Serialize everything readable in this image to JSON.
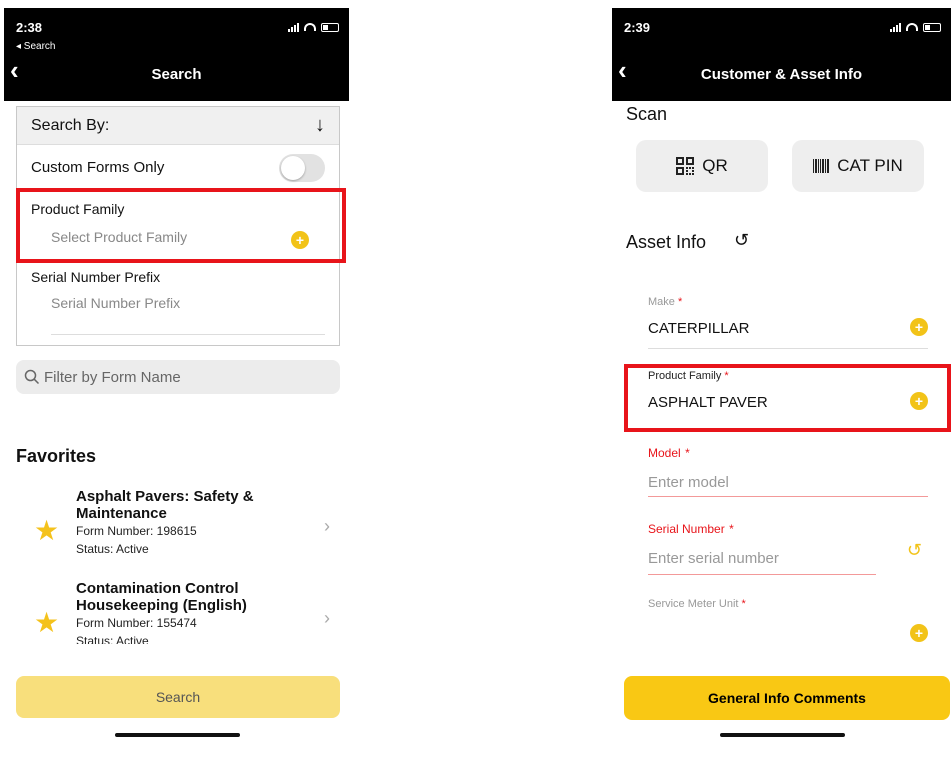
{
  "left": {
    "status": {
      "time": "2:38",
      "sub": "◂ Search"
    },
    "header": {
      "title": "Search"
    },
    "search_by": {
      "label": "Search By:"
    },
    "custom_forms": {
      "label": "Custom Forms Only"
    },
    "product_family": {
      "label": "Product Family",
      "placeholder": "Select Product Family"
    },
    "serial_prefix": {
      "label": "Serial Number Prefix",
      "placeholder": "Serial Number Prefix"
    },
    "filter": {
      "placeholder": "Filter by Form Name"
    },
    "favorites": {
      "title": "Favorites",
      "items": [
        {
          "name": "Asphalt Pavers: Safety & Maintenance",
          "form_number": "Form Number: 198615",
          "status": "Status: Active"
        },
        {
          "name": "Contamination Control Housekeeping (English)",
          "form_number": "Form Number: 155474",
          "status": "Status: Active"
        }
      ]
    },
    "search_button": "Search"
  },
  "right": {
    "status": {
      "time": "2:39"
    },
    "header": {
      "title": "Customer & Asset Info"
    },
    "scan": {
      "title": "Scan",
      "qr_label": "QR",
      "catpin_label": "CAT PIN"
    },
    "asset_info": {
      "title": "Asset Info"
    },
    "make": {
      "label": "Make",
      "value": "CATERPILLAR"
    },
    "product_family": {
      "label": "Product Family",
      "value": "ASPHALT PAVER"
    },
    "model": {
      "label": "Model",
      "placeholder": "Enter model"
    },
    "serial_number": {
      "label": "Serial Number",
      "placeholder": "Enter serial number"
    },
    "service_meter": {
      "label": "Service Meter Unit"
    },
    "required_mark": "*",
    "comments_button": "General Info Comments"
  },
  "colors": {
    "accent_yellow": "#f9c814",
    "highlight_red": "#e8141a",
    "header_black": "#000000"
  }
}
